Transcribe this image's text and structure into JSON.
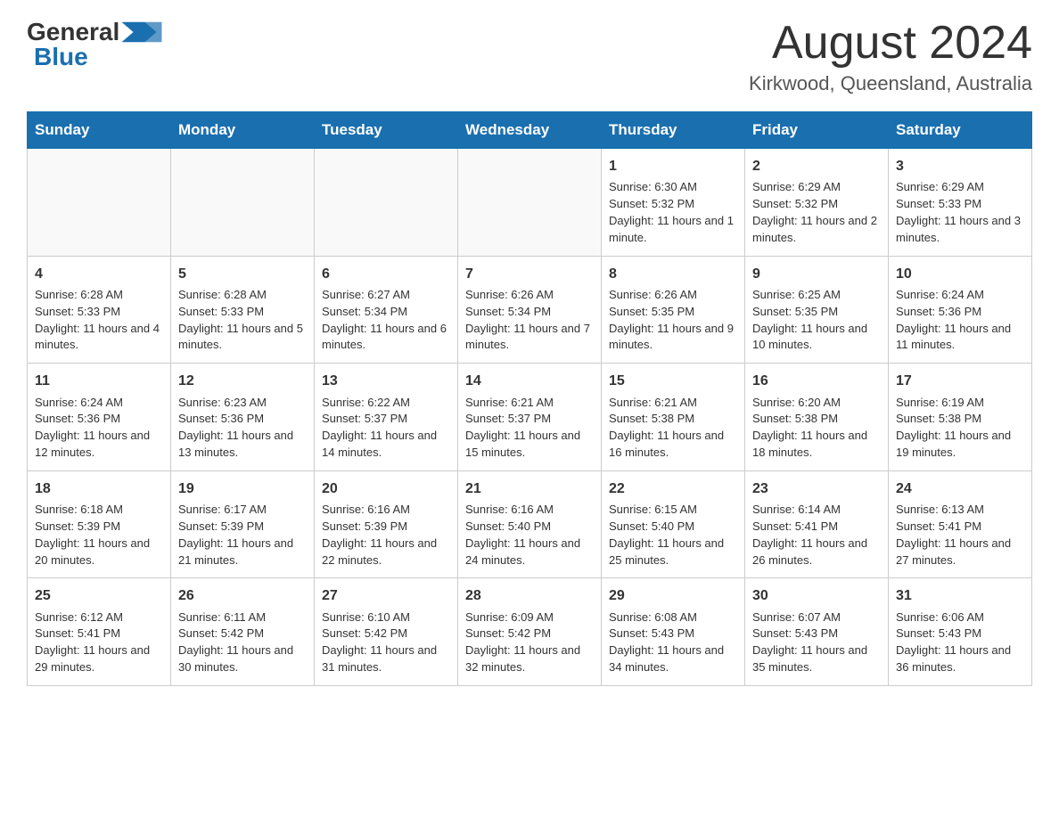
{
  "header": {
    "logo_general": "General",
    "logo_blue": "Blue",
    "month_title": "August 2024",
    "location": "Kirkwood, Queensland, Australia"
  },
  "days_of_week": [
    "Sunday",
    "Monday",
    "Tuesday",
    "Wednesday",
    "Thursday",
    "Friday",
    "Saturday"
  ],
  "weeks": [
    [
      {
        "day": "",
        "info": ""
      },
      {
        "day": "",
        "info": ""
      },
      {
        "day": "",
        "info": ""
      },
      {
        "day": "",
        "info": ""
      },
      {
        "day": "1",
        "info": "Sunrise: 6:30 AM\nSunset: 5:32 PM\nDaylight: 11 hours and 1 minute."
      },
      {
        "day": "2",
        "info": "Sunrise: 6:29 AM\nSunset: 5:32 PM\nDaylight: 11 hours and 2 minutes."
      },
      {
        "day": "3",
        "info": "Sunrise: 6:29 AM\nSunset: 5:33 PM\nDaylight: 11 hours and 3 minutes."
      }
    ],
    [
      {
        "day": "4",
        "info": "Sunrise: 6:28 AM\nSunset: 5:33 PM\nDaylight: 11 hours and 4 minutes."
      },
      {
        "day": "5",
        "info": "Sunrise: 6:28 AM\nSunset: 5:33 PM\nDaylight: 11 hours and 5 minutes."
      },
      {
        "day": "6",
        "info": "Sunrise: 6:27 AM\nSunset: 5:34 PM\nDaylight: 11 hours and 6 minutes."
      },
      {
        "day": "7",
        "info": "Sunrise: 6:26 AM\nSunset: 5:34 PM\nDaylight: 11 hours and 7 minutes."
      },
      {
        "day": "8",
        "info": "Sunrise: 6:26 AM\nSunset: 5:35 PM\nDaylight: 11 hours and 9 minutes."
      },
      {
        "day": "9",
        "info": "Sunrise: 6:25 AM\nSunset: 5:35 PM\nDaylight: 11 hours and 10 minutes."
      },
      {
        "day": "10",
        "info": "Sunrise: 6:24 AM\nSunset: 5:36 PM\nDaylight: 11 hours and 11 minutes."
      }
    ],
    [
      {
        "day": "11",
        "info": "Sunrise: 6:24 AM\nSunset: 5:36 PM\nDaylight: 11 hours and 12 minutes."
      },
      {
        "day": "12",
        "info": "Sunrise: 6:23 AM\nSunset: 5:36 PM\nDaylight: 11 hours and 13 minutes."
      },
      {
        "day": "13",
        "info": "Sunrise: 6:22 AM\nSunset: 5:37 PM\nDaylight: 11 hours and 14 minutes."
      },
      {
        "day": "14",
        "info": "Sunrise: 6:21 AM\nSunset: 5:37 PM\nDaylight: 11 hours and 15 minutes."
      },
      {
        "day": "15",
        "info": "Sunrise: 6:21 AM\nSunset: 5:38 PM\nDaylight: 11 hours and 16 minutes."
      },
      {
        "day": "16",
        "info": "Sunrise: 6:20 AM\nSunset: 5:38 PM\nDaylight: 11 hours and 18 minutes."
      },
      {
        "day": "17",
        "info": "Sunrise: 6:19 AM\nSunset: 5:38 PM\nDaylight: 11 hours and 19 minutes."
      }
    ],
    [
      {
        "day": "18",
        "info": "Sunrise: 6:18 AM\nSunset: 5:39 PM\nDaylight: 11 hours and 20 minutes."
      },
      {
        "day": "19",
        "info": "Sunrise: 6:17 AM\nSunset: 5:39 PM\nDaylight: 11 hours and 21 minutes."
      },
      {
        "day": "20",
        "info": "Sunrise: 6:16 AM\nSunset: 5:39 PM\nDaylight: 11 hours and 22 minutes."
      },
      {
        "day": "21",
        "info": "Sunrise: 6:16 AM\nSunset: 5:40 PM\nDaylight: 11 hours and 24 minutes."
      },
      {
        "day": "22",
        "info": "Sunrise: 6:15 AM\nSunset: 5:40 PM\nDaylight: 11 hours and 25 minutes."
      },
      {
        "day": "23",
        "info": "Sunrise: 6:14 AM\nSunset: 5:41 PM\nDaylight: 11 hours and 26 minutes."
      },
      {
        "day": "24",
        "info": "Sunrise: 6:13 AM\nSunset: 5:41 PM\nDaylight: 11 hours and 27 minutes."
      }
    ],
    [
      {
        "day": "25",
        "info": "Sunrise: 6:12 AM\nSunset: 5:41 PM\nDaylight: 11 hours and 29 minutes."
      },
      {
        "day": "26",
        "info": "Sunrise: 6:11 AM\nSunset: 5:42 PM\nDaylight: 11 hours and 30 minutes."
      },
      {
        "day": "27",
        "info": "Sunrise: 6:10 AM\nSunset: 5:42 PM\nDaylight: 11 hours and 31 minutes."
      },
      {
        "day": "28",
        "info": "Sunrise: 6:09 AM\nSunset: 5:42 PM\nDaylight: 11 hours and 32 minutes."
      },
      {
        "day": "29",
        "info": "Sunrise: 6:08 AM\nSunset: 5:43 PM\nDaylight: 11 hours and 34 minutes."
      },
      {
        "day": "30",
        "info": "Sunrise: 6:07 AM\nSunset: 5:43 PM\nDaylight: 11 hours and 35 minutes."
      },
      {
        "day": "31",
        "info": "Sunrise: 6:06 AM\nSunset: 5:43 PM\nDaylight: 11 hours and 36 minutes."
      }
    ]
  ]
}
